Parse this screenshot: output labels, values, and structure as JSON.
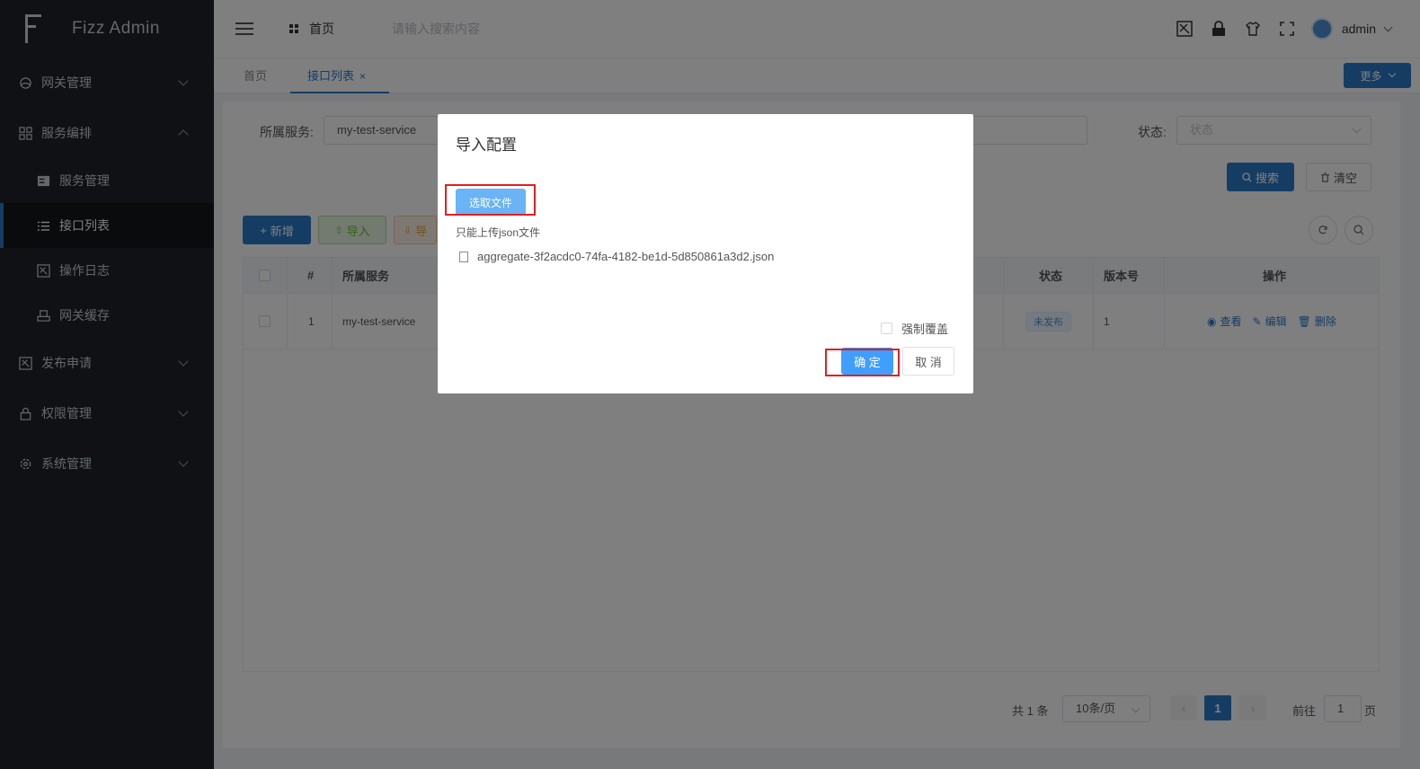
{
  "app": {
    "title": "Fizz Admin"
  },
  "sidebar": {
    "items": [
      {
        "label": "网关管理",
        "icon": "cloud-icon",
        "expanded": false
      },
      {
        "label": "服务编排",
        "icon": "grid-icon",
        "expanded": true,
        "children": [
          {
            "label": "服务管理",
            "icon": "server-icon"
          },
          {
            "label": "接口列表",
            "icon": "list-icon",
            "active": true
          },
          {
            "label": "操作日志",
            "icon": "log-icon"
          },
          {
            "label": "网关缓存",
            "icon": "cache-icon"
          }
        ]
      },
      {
        "label": "发布申请",
        "icon": "publish-icon",
        "expanded": false
      },
      {
        "label": "权限管理",
        "icon": "lock-icon",
        "expanded": false
      },
      {
        "label": "系统管理",
        "icon": "gear-icon",
        "expanded": false
      }
    ]
  },
  "header": {
    "home": "首页",
    "search_placeholder": "请输入搜索内容",
    "user": "admin"
  },
  "tabs": {
    "home": "首页",
    "active": "接口列表",
    "close": "×",
    "more": "更多"
  },
  "filters": {
    "service_label": "所属服务:",
    "service_value": "my-test-service",
    "status_label": "状态:",
    "status_placeholder": "状态",
    "search_btn": "搜索",
    "clear_btn": "清空"
  },
  "toolbar": {
    "add": "新增",
    "import": "导入",
    "export": "导"
  },
  "table": {
    "headers": {
      "index": "#",
      "service": "所属服务",
      "status": "状态",
      "version": "版本号",
      "ops": "操作"
    },
    "rows": [
      {
        "index": "1",
        "service": "my-test-service",
        "status": "未发布",
        "version": "1"
      }
    ],
    "ops": {
      "view": "查看",
      "edit": "编辑",
      "delete": "删除"
    }
  },
  "pagination": {
    "total": "共 1 条",
    "page_size": "10条/页",
    "current": "1",
    "goto_prefix": "前往",
    "goto_value": "1",
    "goto_suffix": "页"
  },
  "dialog": {
    "title": "导入配置",
    "upload_btn": "选取文件",
    "tip": "只能上传json文件",
    "file_name": "aggregate-3f2acdc0-74fa-4182-be1d-5d850861a3d2.json",
    "force_label": "强制覆盖",
    "ok": "确 定",
    "cancel": "取 消"
  },
  "colors": {
    "primary": "#2a7ac9",
    "sidebar_bg": "#1f2229",
    "highlight": "#e02020"
  }
}
